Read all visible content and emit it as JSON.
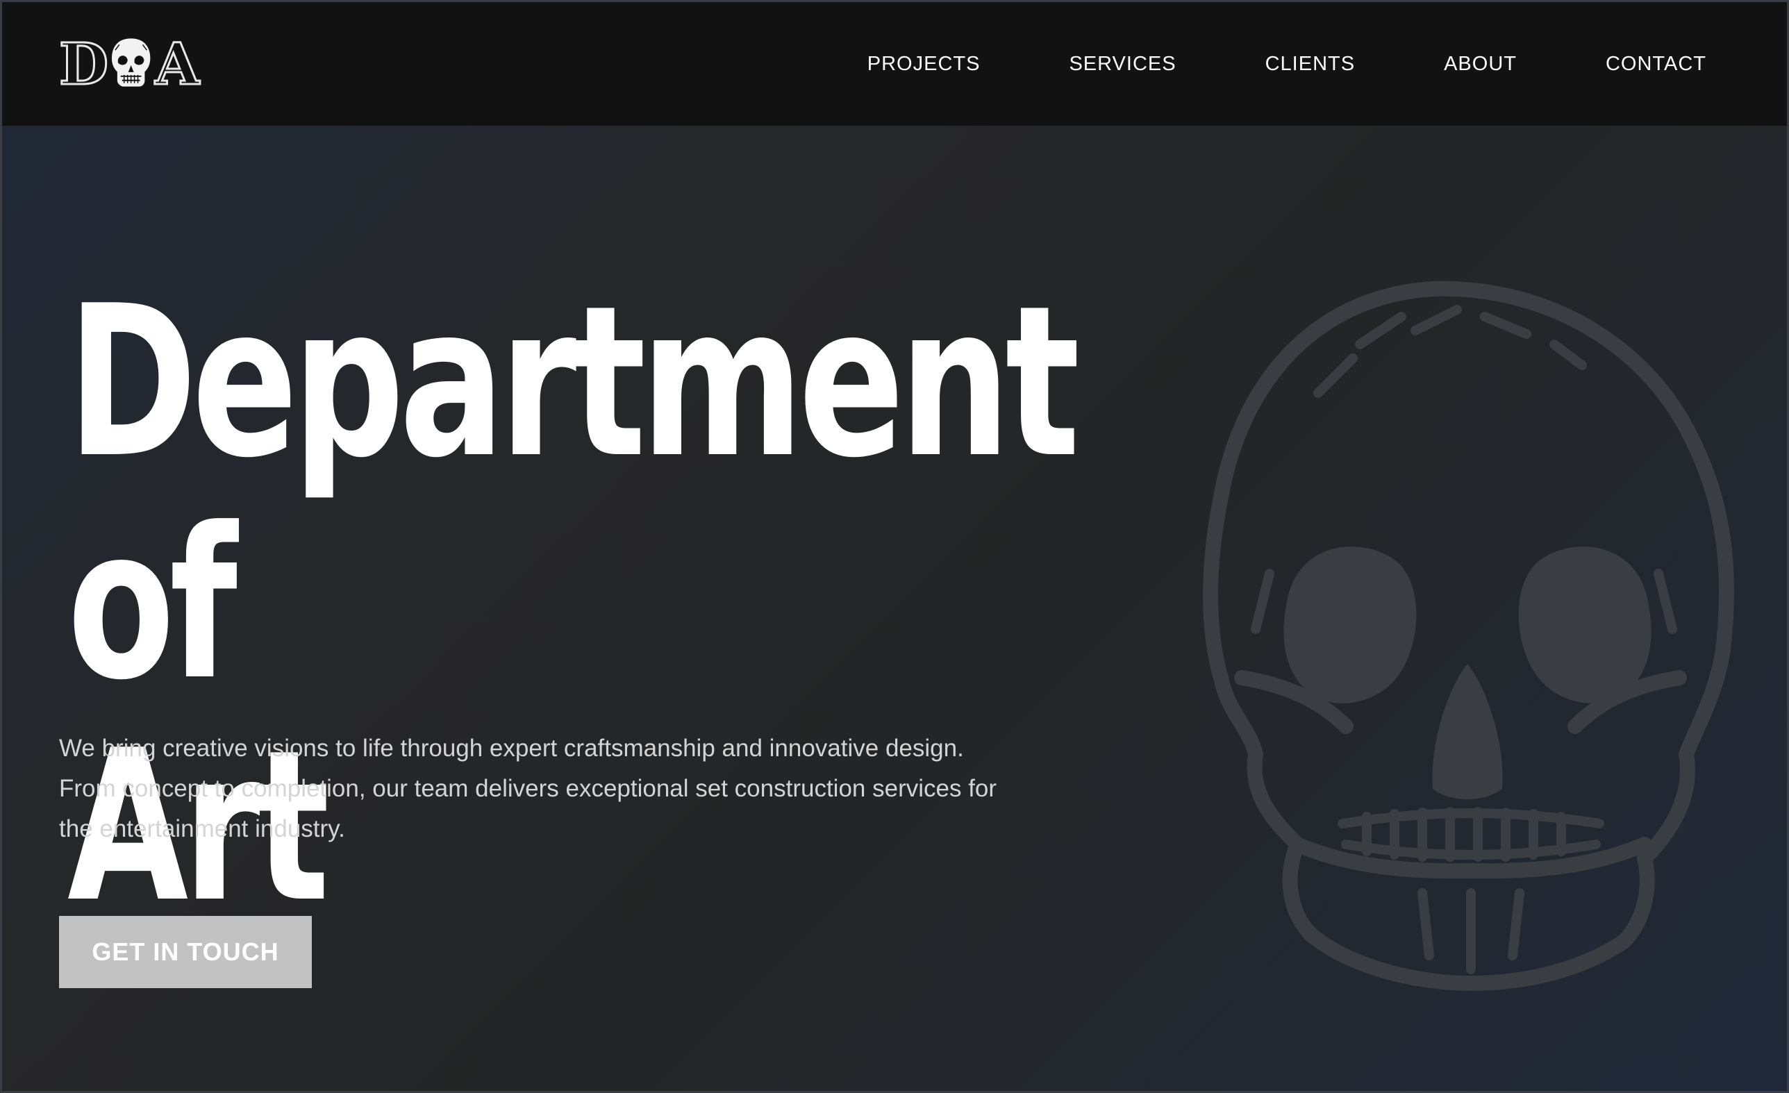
{
  "brand": {
    "logo_text": "DOA",
    "logo_letter_left": "D",
    "logo_letter_right": "A"
  },
  "nav": {
    "items": [
      {
        "label": "PROJECTS"
      },
      {
        "label": "SERVICES"
      },
      {
        "label": "CLIENTS"
      },
      {
        "label": "ABOUT"
      },
      {
        "label": "CONTACT"
      }
    ]
  },
  "hero": {
    "title_line1": "Department of",
    "title_line2": "Art",
    "description": "We bring creative visions to life through expert craftsmanship and innovative design. From concept to completion, our team delivers exceptional set construction services for the entertainment industry.",
    "cta_label": "GET IN TOUCH",
    "background_icon": "skull-icon"
  },
  "colors": {
    "nav_bg": "#121212",
    "hero_bg_dark": "#242526",
    "hero_bg_blue": "#202836",
    "text": "#ffffff",
    "description_text": "#d4d4d4",
    "cta_bg": "#c2c2c2",
    "skull": "#3a3d42"
  }
}
